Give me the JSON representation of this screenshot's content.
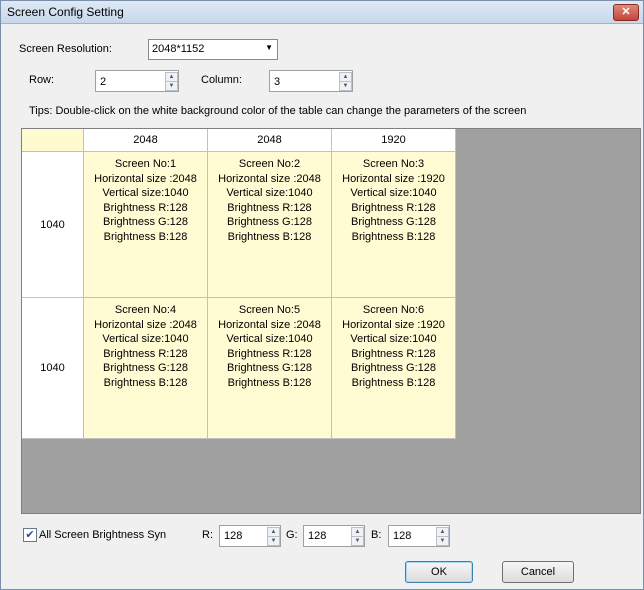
{
  "window": {
    "title": "Screen Config Setting",
    "close_glyph": "✕"
  },
  "resolution": {
    "label": "Screen Resolution:",
    "value": "2048*1152"
  },
  "row": {
    "label": "Row:",
    "value": "2"
  },
  "column": {
    "label": "Column:",
    "value": "3"
  },
  "tips": "Tips: Double-click on the white background color of the table can change the parameters of the screen",
  "grid": {
    "col_headers": [
      "2048",
      "2048",
      "1920"
    ],
    "row_headers": [
      "1040",
      "1040"
    ],
    "screens": [
      [
        "Screen No:1",
        "Horizontal size :2048",
        "Vertical size:1040",
        "Brightness R:128",
        "Brightness G:128",
        "Brightness B:128"
      ],
      [
        "Screen No:2",
        "Horizontal size :2048",
        "Vertical size:1040",
        "Brightness R:128",
        "Brightness G:128",
        "Brightness B:128"
      ],
      [
        "Screen No:3",
        "Horizontal size :1920",
        "Vertical size:1040",
        "Brightness R:128",
        "Brightness G:128",
        "Brightness B:128"
      ],
      [
        "Screen No:4",
        "Horizontal size :2048",
        "Vertical size:1040",
        "Brightness R:128",
        "Brightness G:128",
        "Brightness B:128"
      ],
      [
        "Screen No:5",
        "Horizontal size :2048",
        "Vertical size:1040",
        "Brightness R:128",
        "Brightness G:128",
        "Brightness B:128"
      ],
      [
        "Screen No:6",
        "Horizontal size :1920",
        "Vertical size:1040",
        "Brightness R:128",
        "Brightness G:128",
        "Brightness B:128"
      ]
    ]
  },
  "brightness": {
    "sync_label": "All Screen Brightness Syn",
    "sync_checked": true,
    "r_label": "R:",
    "r_value": "128",
    "g_label": "G:",
    "g_value": "128",
    "b_label": "B:",
    "b_value": "128"
  },
  "buttons": {
    "ok": "OK",
    "cancel": "Cancel"
  },
  "colors": {
    "screen_cell": "#fffbd2",
    "grid_background": "#a0a0a0",
    "title_bar": "#c7d7ea"
  }
}
